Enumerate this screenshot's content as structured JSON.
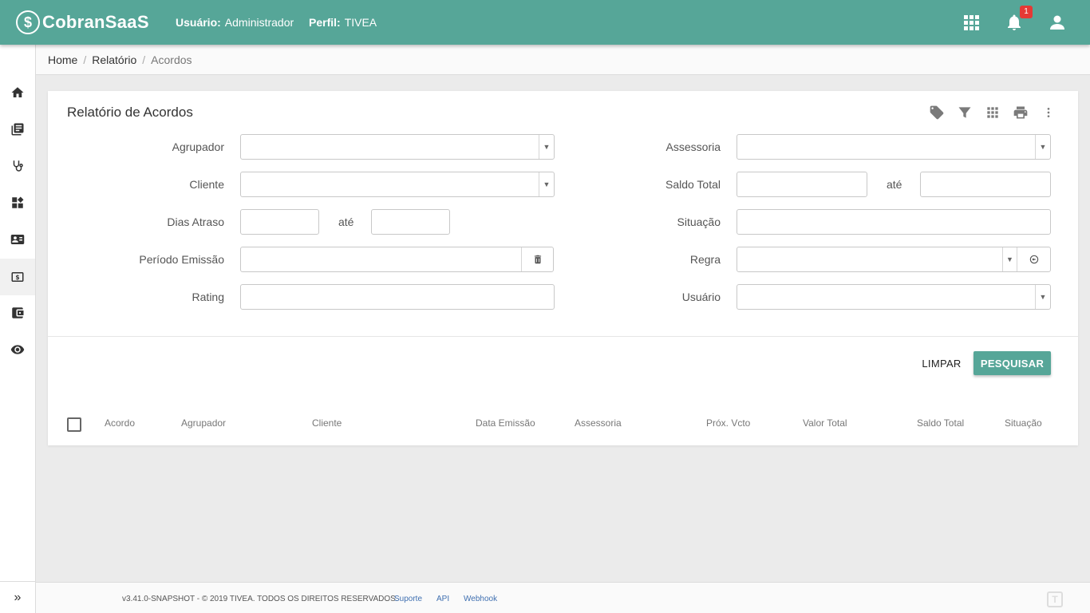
{
  "header": {
    "brand": "CobranSaaS",
    "brand_mark": "$",
    "user_label": "Usuário:",
    "user_value": "Administrador",
    "profile_label": "Perfil:",
    "profile_value": "TIVEA",
    "notifications_count": "1",
    "icons": [
      "apps-grid-icon",
      "bell-icon",
      "user-icon"
    ]
  },
  "sidebar": {
    "items": [
      "home-icon",
      "library-books-icon",
      "stethoscope-icon",
      "dashboard-icon",
      "contact-card-icon",
      "money-icon",
      "wallet-icon",
      "eye-icon"
    ],
    "active_index": 5,
    "expand": "»"
  },
  "breadcrumb": {
    "items": [
      "Home",
      "Relatório"
    ],
    "current": "Acordos"
  },
  "card": {
    "title": "Relatório de Acordos",
    "tools": [
      "tag-icon",
      "filter-icon",
      "grid-icon",
      "print-icon",
      "more-vert-icon"
    ]
  },
  "form": {
    "agrupador": {
      "label": "Agrupador",
      "value": ""
    },
    "cliente": {
      "label": "Cliente",
      "value": ""
    },
    "dias_atraso": {
      "label": "Dias Atraso",
      "from": "",
      "to_label": "até",
      "to": ""
    },
    "periodo_emissao": {
      "label": "Período Emissão",
      "value": ""
    },
    "rating": {
      "label": "Rating",
      "value": ""
    },
    "assessoria": {
      "label": "Assessoria",
      "value": ""
    },
    "saldo_total": {
      "label": "Saldo Total",
      "from": "",
      "to_label": "até",
      "to": ""
    },
    "situacao": {
      "label": "Situação",
      "value": ""
    },
    "regra": {
      "label": "Regra",
      "value": ""
    },
    "usuario": {
      "label": "Usuário",
      "value": ""
    }
  },
  "actions": {
    "clear": "LIMPAR",
    "search": "PESQUISAR"
  },
  "table": {
    "columns": [
      "Acordo",
      "Agrupador",
      "Cliente",
      "Data Emissão",
      "Assessoria",
      "Próx. Vcto",
      "Valor Total",
      "Saldo Total",
      "Situação"
    ],
    "rows": []
  },
  "footer": {
    "copyright": "v3.41.0-SNAPSHOT - © 2019 TIVEA. TODOS OS DIREITOS RESERVADOS.",
    "links": [
      "Suporte",
      "API",
      "Webhook"
    ]
  },
  "colors": {
    "primary": "#56a698",
    "badge": "#e53935",
    "background": "#ebebeb"
  }
}
